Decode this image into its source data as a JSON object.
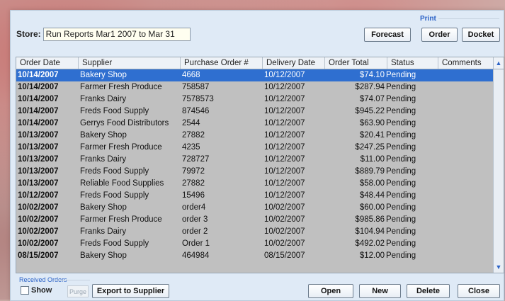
{
  "store": {
    "label": "Store:",
    "value": "Run Reports Mar1 2007 to Mar 31"
  },
  "print": {
    "group_label": "Print",
    "forecast": "Forecast",
    "order": "Order",
    "docket": "Docket"
  },
  "columns": [
    "Order Date",
    "Supplier",
    "Purchase Order #",
    "Delivery Date",
    "Order Total",
    "Status",
    "Comments"
  ],
  "rows": [
    {
      "date": "10/14/2007",
      "supplier": "Bakery Shop",
      "po": "4668",
      "delivery": "10/12/2007",
      "total": "$74.10",
      "status": "Pending",
      "selected": true
    },
    {
      "date": "10/14/2007",
      "supplier": "Farmer Fresh Produce",
      "po": "758587",
      "delivery": "10/12/2007",
      "total": "$287.94",
      "status": "Pending"
    },
    {
      "date": "10/14/2007",
      "supplier": "Franks Dairy",
      "po": "7578573",
      "delivery": "10/12/2007",
      "total": "$74.07",
      "status": "Pending"
    },
    {
      "date": "10/14/2007",
      "supplier": "Freds Food Supply",
      "po": "874546",
      "delivery": "10/12/2007",
      "total": "$945.22",
      "status": "Pending"
    },
    {
      "date": "10/14/2007",
      "supplier": "Gerrys Food Distributors",
      "po": "2544",
      "delivery": "10/12/2007",
      "total": "$63.90",
      "status": "Pending"
    },
    {
      "date": "10/13/2007",
      "supplier": "Bakery Shop",
      "po": "27882",
      "delivery": "10/12/2007",
      "total": "$20.41",
      "status": "Pending"
    },
    {
      "date": "10/13/2007",
      "supplier": "Farmer Fresh Produce",
      "po": "4235",
      "delivery": "10/12/2007",
      "total": "$247.25",
      "status": "Pending"
    },
    {
      "date": "10/13/2007",
      "supplier": "Franks Dairy",
      "po": "728727",
      "delivery": "10/12/2007",
      "total": "$11.00",
      "status": "Pending"
    },
    {
      "date": "10/13/2007",
      "supplier": "Freds Food Supply",
      "po": "79972",
      "delivery": "10/12/2007",
      "total": "$889.79",
      "status": "Pending"
    },
    {
      "date": "10/13/2007",
      "supplier": "Reliable Food Supplies",
      "po": "27882",
      "delivery": "10/12/2007",
      "total": "$58.00",
      "status": "Pending"
    },
    {
      "date": "10/12/2007",
      "supplier": "Freds Food Supply",
      "po": "15496",
      "delivery": "10/12/2007",
      "total": "$48.44",
      "status": "Pending"
    },
    {
      "date": "10/02/2007",
      "supplier": "Bakery Shop",
      "po": "order4",
      "delivery": "10/02/2007",
      "total": "$60.00",
      "status": "Pending"
    },
    {
      "date": "10/02/2007",
      "supplier": "Farmer Fresh Produce",
      "po": "order 3",
      "delivery": "10/02/2007",
      "total": "$985.86",
      "status": "Pending"
    },
    {
      "date": "10/02/2007",
      "supplier": "Franks Dairy",
      "po": "order 2",
      "delivery": "10/02/2007",
      "total": "$104.94",
      "status": "Pending"
    },
    {
      "date": "10/02/2007",
      "supplier": "Freds Food Supply",
      "po": "Order 1",
      "delivery": "10/02/2007",
      "total": "$492.02",
      "status": "Pending"
    },
    {
      "date": "08/15/2007",
      "supplier": "Bakery Shop",
      "po": "464984",
      "delivery": "08/15/2007",
      "total": "$12.00",
      "status": "Pending"
    }
  ],
  "received": {
    "group_label": "Received Orders",
    "show": "Show",
    "purge": "Purge"
  },
  "buttons": {
    "export": "Export to Supplier",
    "open": "Open",
    "new": "New",
    "delete": "Delete",
    "close": "Close"
  },
  "colors": {
    "selection": "#2f6fd0",
    "accent": "#2c63c7",
    "panel": "#dfeaf6"
  },
  "icons": {
    "scroll_up": "chevron-up-icon",
    "scroll_down": "chevron-down-icon"
  }
}
